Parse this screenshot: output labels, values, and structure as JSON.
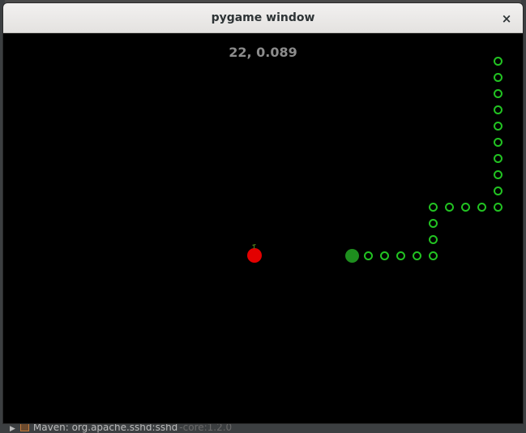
{
  "window": {
    "title": "pygame window",
    "close_glyph": "×"
  },
  "game": {
    "score_text": "22, 0.089",
    "colors": {
      "background": "#000000",
      "snake_body": "#22c322",
      "snake_head": "#1e8e1e",
      "apple": "#e30000",
      "score": "#8c8c8c"
    },
    "grid_cell": 20,
    "snake": {
      "head": [
        21,
        13
      ],
      "body": [
        [
          22,
          13
        ],
        [
          23,
          13
        ],
        [
          24,
          13
        ],
        [
          25,
          13
        ],
        [
          26,
          13
        ],
        [
          26,
          12
        ],
        [
          26,
          11
        ],
        [
          26,
          10
        ],
        [
          27,
          10
        ],
        [
          28,
          10
        ],
        [
          29,
          10
        ],
        [
          30,
          10
        ],
        [
          30,
          9
        ],
        [
          30,
          8
        ],
        [
          30,
          7
        ],
        [
          30,
          6
        ],
        [
          30,
          5
        ],
        [
          30,
          4
        ],
        [
          30,
          3
        ],
        [
          30,
          2
        ],
        [
          30,
          1
        ]
      ]
    },
    "apple": [
      15,
      13
    ]
  },
  "background_app": {
    "status_text": "Maven: org.apache.sshd:sshd",
    "status_text_dim": "-core:1.2.0"
  }
}
